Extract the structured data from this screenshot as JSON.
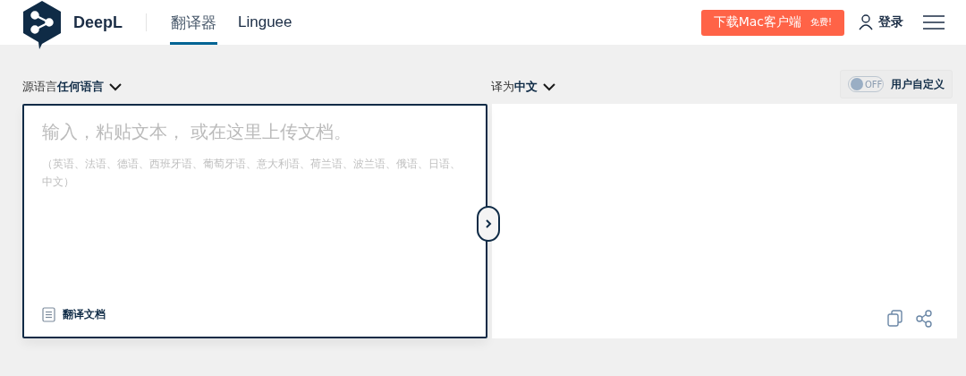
{
  "header": {
    "brand": "DeepL",
    "tabs": [
      {
        "label": "翻译器",
        "selected": true
      },
      {
        "label": "Linguee",
        "selected": false
      }
    ],
    "download_button": {
      "label": "下载Mac客户端",
      "badge": "免费!"
    },
    "login": "登录"
  },
  "source": {
    "label": "源语言",
    "language": "任何语言",
    "placeholder": "输入，粘贴文本， 或在这里上传文档。",
    "hint": "（英语、法语、德语、西班牙语、葡萄牙语、意大利语、荷兰语、波兰语、俄语、日语、中文）",
    "document_button": "翻译文档"
  },
  "target": {
    "label": "译为",
    "language": "中文",
    "glossary_toggle": {
      "on": false,
      "state_label": "OFF",
      "label": "用户自定义"
    }
  }
}
